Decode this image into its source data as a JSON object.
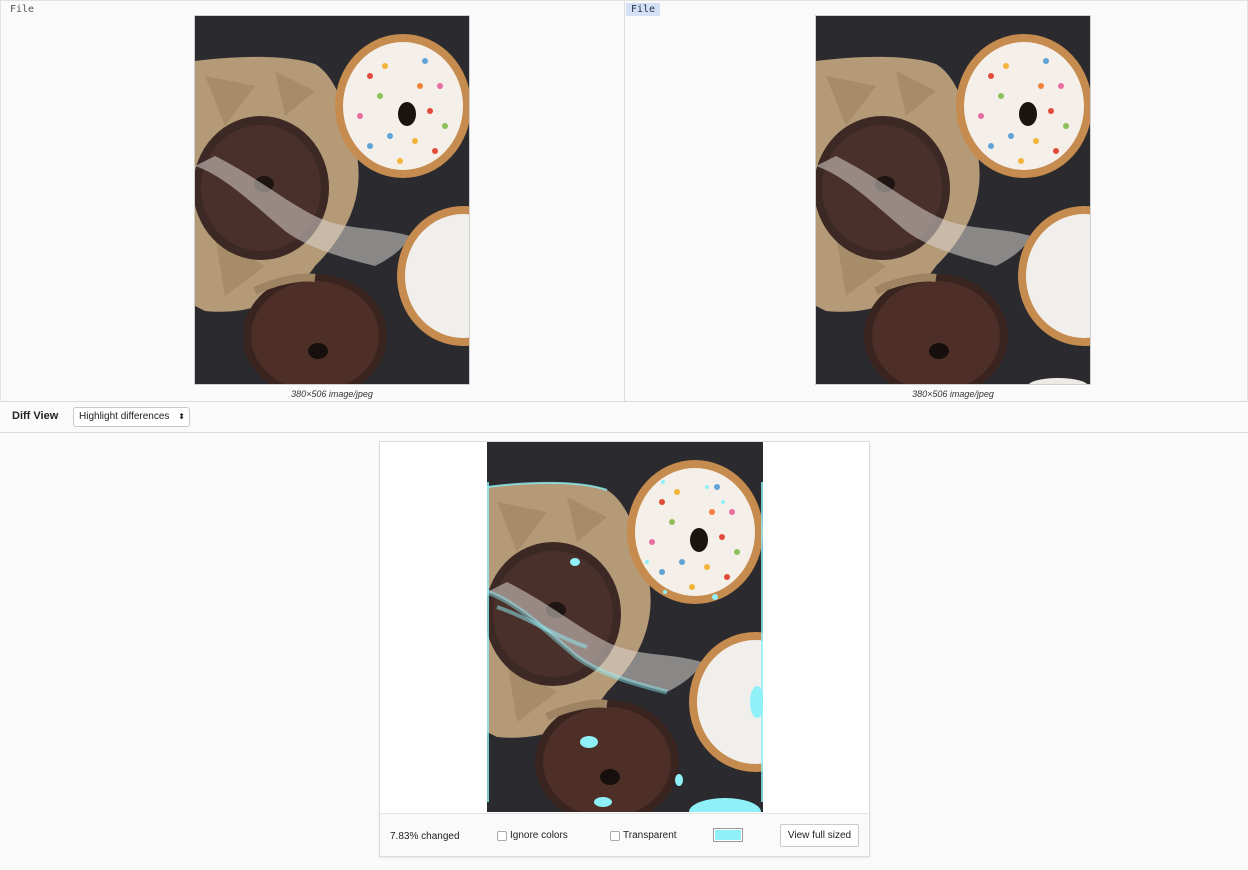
{
  "left_pane": {
    "file_label": "File",
    "image_meta": "380×506 image/jpeg"
  },
  "right_pane": {
    "file_label": "File",
    "image_meta": "380×506 image/jpeg"
  },
  "diff_bar": {
    "title": "Diff View",
    "mode_selected": "Highlight differences"
  },
  "diff_footer": {
    "changed_text": "7.83% changed",
    "ignore_colors_label": "Ignore colors",
    "transparent_label": "Transparent",
    "highlight_color": "#8ff0f8",
    "view_full_label": "View full sized"
  },
  "icons": {
    "select_caret": "updown-caret-icon",
    "checkbox": "checkbox-icon"
  }
}
